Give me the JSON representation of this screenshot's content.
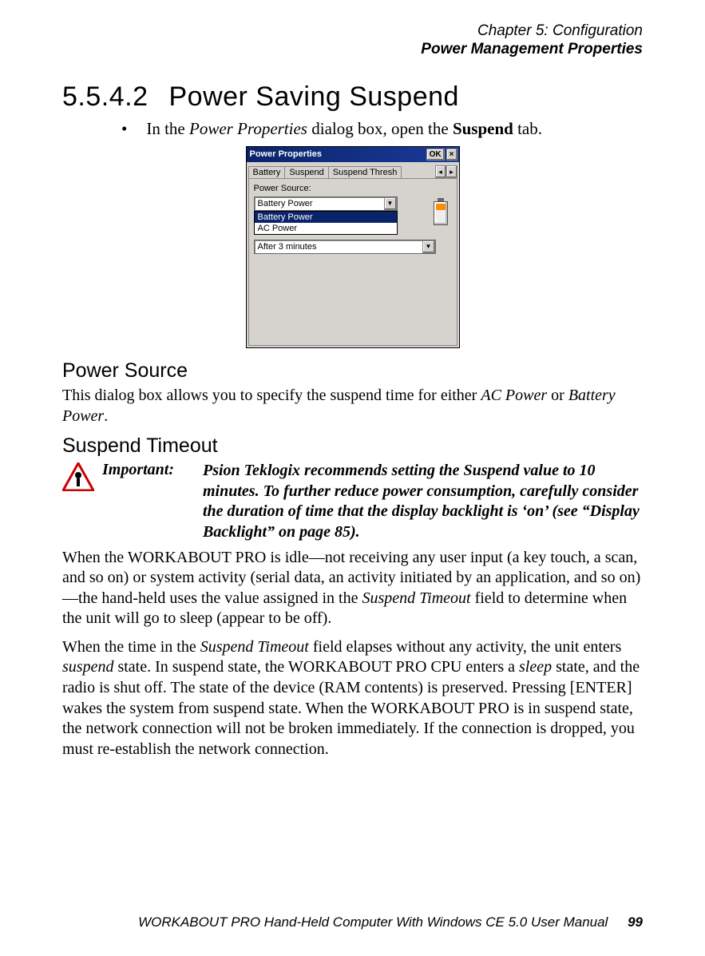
{
  "header": {
    "line1": "Chapter 5: Configuration",
    "line2": "Power Management Properties"
  },
  "section": {
    "number": "5.5.4.2",
    "title": "Power Saving Suspend"
  },
  "bullet1": {
    "pre": "In the ",
    "italic": "Power Properties",
    "mid": " dialog box, open the ",
    "bold": "Suspend",
    "post": " tab."
  },
  "dialog": {
    "title": "Power Properties",
    "ok_label": "OK",
    "close_label": "×",
    "tabs": [
      "Battery",
      "Suspend",
      "Suspend Thresh"
    ],
    "active_tab_index": 1,
    "scroll_left": "◂",
    "scroll_right": "▸",
    "power_source_label": "Power Source:",
    "combo1_value": "Battery Power",
    "dropdown_options": [
      "Battery Power",
      "AC Power"
    ],
    "dropdown_selected_index": 0,
    "combo2_value": "After 3 minutes",
    "dd_glyph": "▼"
  },
  "subhead1": "Power Source",
  "para1": {
    "pre": "This dialog box allows you to specify the suspend time for either ",
    "it1": "AC Power",
    "mid": " or ",
    "it2": "Battery Power",
    "post": "."
  },
  "subhead2": "Suspend Timeout",
  "important": {
    "label": "Important:",
    "text": "Psion Teklogix recommends setting the Suspend value to 10 minutes. To further reduce power consumption, carefully consider the duration of time that the display backlight is ‘on’ (see “Display Backlight” on page 85)."
  },
  "para2": {
    "pre": "When the WORKABOUT PRO is idle—not receiving any user input (a key touch, a scan, and so on) or system activity (serial data, an activity initiated by an application, and so on)—the hand-held uses the value assigned in the ",
    "it1": "Suspend Timeout",
    "post": " field to determine when the unit will go to sleep (appear to be off)."
  },
  "para3": {
    "pre": "When the time in the ",
    "it1": "Suspend Timeout",
    "mid": " field elapses without any activity, the unit enters ",
    "it2": "suspend",
    "mid2": " state. In suspend state, the WORKABOUT PRO CPU enters a ",
    "it3": "sleep",
    "post": " state, and the radio is shut off. The state of the device (RAM contents) is preserved. Pressing [ENTER] wakes the system from suspend state. When the WORKABOUT PRO is in suspend state, the network connection will not be broken immediately. If the connection is dropped, you must re-establish the network connection."
  },
  "footer": {
    "text": "WORKABOUT PRO Hand-Held Computer With Windows CE 5.0 User Manual",
    "page": "99"
  }
}
